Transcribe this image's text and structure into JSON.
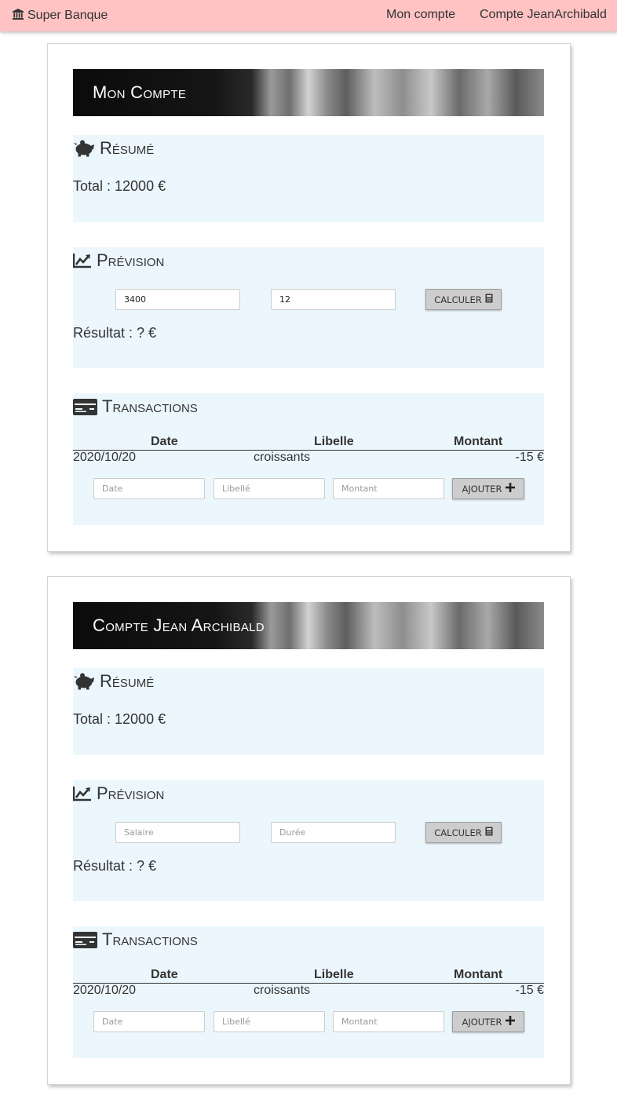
{
  "navbar": {
    "brand": "Super Banque",
    "brand_icon": "bank-icon",
    "links": [
      "Mon compte",
      "Compte JeanArchibald"
    ]
  },
  "accounts": [
    {
      "title": "Mon Compte",
      "resume": {
        "heading": "Résumé",
        "icon": "piggy-bank-icon",
        "total": "Total : 12000 €"
      },
      "prevision": {
        "heading": "Prévision",
        "icon": "chart-line-icon",
        "salaire_value": "3400",
        "salaire_placeholder": "Salaire",
        "duree_value": "12",
        "duree_placeholder": "Durée",
        "button": "CALCULER",
        "result": "Résultat : ? €"
      },
      "transactions": {
        "heading": "Transactions",
        "icon": "credit-card-icon",
        "columns": [
          "Date",
          "Libelle",
          "Montant"
        ],
        "rows": [
          {
            "date": "2020/10/20",
            "libelle": "croissants",
            "montant": "-15 €"
          }
        ],
        "placeholders": {
          "date": "Date",
          "libelle": "Libellé",
          "montant": "Montant"
        },
        "button": "AJOUTER"
      }
    },
    {
      "title": "Compte Jean Archibald",
      "resume": {
        "heading": "Résumé",
        "icon": "piggy-bank-icon",
        "total": "Total : 12000 €"
      },
      "prevision": {
        "heading": "Prévision",
        "icon": "chart-line-icon",
        "salaire_value": "",
        "salaire_placeholder": "Salaire",
        "duree_value": "",
        "duree_placeholder": "Durée",
        "button": "CALCULER",
        "result": "Résultat : ? €"
      },
      "transactions": {
        "heading": "Transactions",
        "icon": "credit-card-icon",
        "columns": [
          "Date",
          "Libelle",
          "Montant"
        ],
        "rows": [
          {
            "date": "2020/10/20",
            "libelle": "croissants",
            "montant": "-15 €"
          }
        ],
        "placeholders": {
          "date": "Date",
          "libelle": "Libellé",
          "montant": "Montant"
        },
        "button": "AJOUTER"
      }
    }
  ],
  "colors": {
    "navbar_bg": "#ffc3c3",
    "section_bg": "#ecf7fd",
    "button_bg": "#cdcdcd"
  }
}
